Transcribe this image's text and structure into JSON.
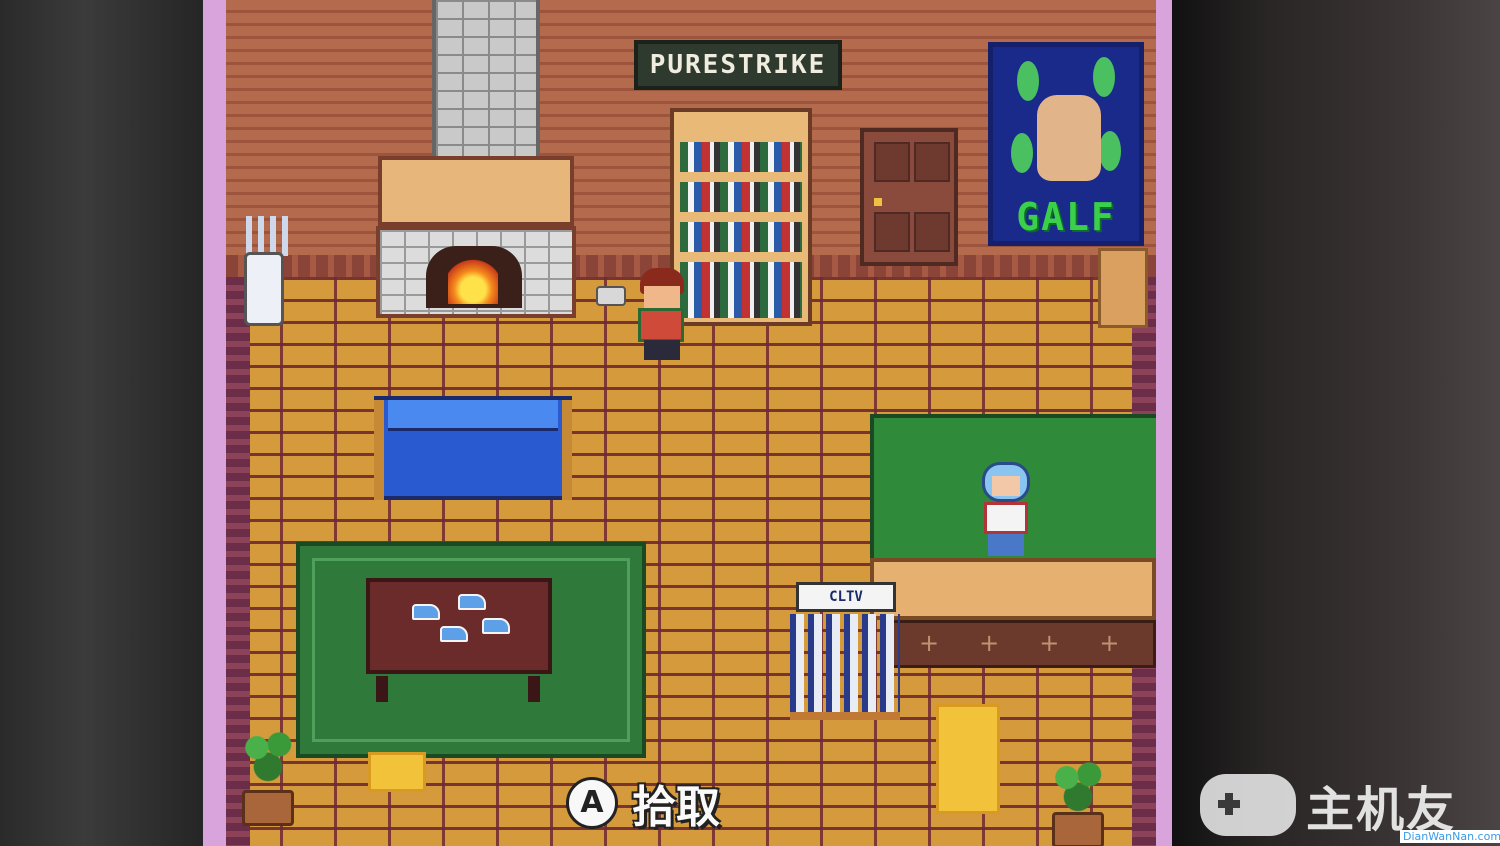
{
  "game": {
    "shop_sign": "PURESTRIKE",
    "poster_title": "GALF",
    "rack_sign": "CLTV"
  },
  "prompt": {
    "button": "A",
    "label": "拾取"
  },
  "watermark": {
    "brand": "主机友",
    "url": "DianWanNan.com"
  },
  "colors": {
    "wall": "#b46a4c",
    "floor": "#d59a3c",
    "rug": "#2f7a3a",
    "sofa": "#2a5ad0",
    "frame": "#d9a3dc"
  }
}
